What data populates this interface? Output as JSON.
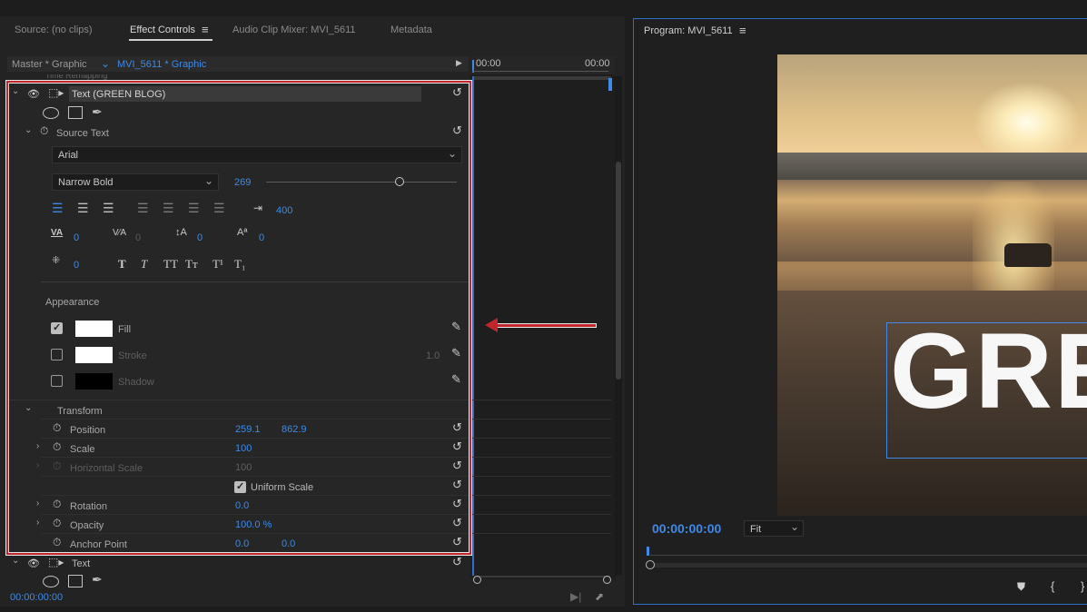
{
  "tabs": [
    {
      "label": "Source: (no clips)",
      "active": false
    },
    {
      "label": "Effect Controls",
      "active": true
    },
    {
      "label": "Audio Clip Mixer: MVI_5611",
      "active": false
    },
    {
      "label": "Metadata",
      "active": false
    }
  ],
  "clip_header": {
    "master": "Master * Graphic",
    "clip": "MVI_5611 * Graphic",
    "time_start": "00:00",
    "time_end": "00:00",
    "partial_row": "Time Remapping"
  },
  "text_layer": {
    "name": "Text (GREEN BLOG)",
    "source_text_label": "Source Text",
    "font": "Arial",
    "font_style": "Narrow Bold",
    "font_size": "269",
    "font_size_slider": 0.7,
    "tab_width": "400",
    "kerning": "0",
    "tracking": "0",
    "leading": "0",
    "baseline_shift": "0",
    "tsume": "0",
    "style_buttons": [
      "T",
      "T",
      "TT",
      "Tт",
      "T¹",
      "T₁"
    ]
  },
  "appearance": {
    "label": "Appearance",
    "fill": {
      "label": "Fill",
      "checked": true,
      "color": "#ffffff"
    },
    "stroke": {
      "label": "Stroke",
      "checked": false,
      "color": "#ffffff",
      "width": "1.0"
    },
    "shadow": {
      "label": "Shadow",
      "checked": false,
      "color": "#000000"
    }
  },
  "transform": {
    "label": "Transform",
    "position_label": "Position",
    "position_x": "259.1",
    "position_y": "862.9",
    "scale_label": "Scale",
    "scale": "100",
    "hscale_label": "Horizontal Scale",
    "hscale": "100",
    "uniform_label": "Uniform Scale",
    "rotation_label": "Rotation",
    "rotation": "0.0",
    "opacity_label": "Opacity",
    "opacity": "100.0 %",
    "anchor_label": "Anchor Point",
    "anchor_x": "0.0",
    "anchor_y": "0.0"
  },
  "second_layer": {
    "name": "Text"
  },
  "bottom_timecode": "00:00:00:00",
  "program": {
    "title": "Program: MVI_5611",
    "timecode": "00:00:00:00",
    "fit": "Fit",
    "overlay_text": "GREEN BLOG"
  },
  "colors": {
    "accent": "#3e8ae6",
    "highlight": "#c0262c",
    "panel": "#232323"
  }
}
